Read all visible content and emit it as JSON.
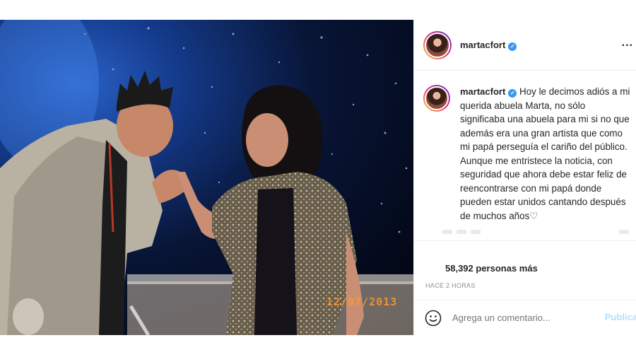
{
  "header": {
    "username": "martacfort",
    "more_label": "..."
  },
  "caption": {
    "username": "martacfort",
    "text": "Hoy le decimos adiós a mi querida abuela Marta, no sólo significaba una abuela para mi si no que además era una gran artista que como mi papá perseguía el cariño del público. Aunque me entristece la noticia, con seguridad que ahora debe estar feliz de reencontrarse con mi papá donde pueden estar unidos cantando después de muchos años♡"
  },
  "photo": {
    "date_stamp": "12/07/2013"
  },
  "likes": {
    "text": "58,392 personas más"
  },
  "timestamp": "HACE 2 HORAS",
  "comment": {
    "placeholder": "Agrega un comentario...",
    "post_label": "Publicar"
  },
  "colors": {
    "link_blue_disabled": "#b2dffc",
    "verified_blue": "#3897f0",
    "stamp_orange": "#ff9a2a"
  }
}
